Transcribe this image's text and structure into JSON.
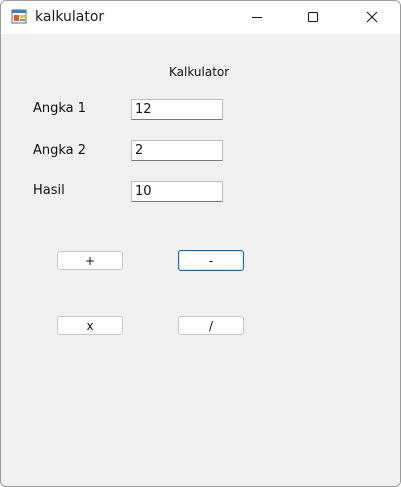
{
  "window": {
    "title": "kalkulator",
    "icon": "winforms-app-icon",
    "controls": [
      "minimize-icon",
      "maximize-icon",
      "close-icon"
    ]
  },
  "form": {
    "title": "Kalkulator",
    "fields": [
      {
        "label": "Angka 1",
        "value": "12"
      },
      {
        "label": "Angka 2",
        "value": "2"
      },
      {
        "label": "Hasil",
        "value": "10"
      }
    ],
    "buttons": {
      "add": "+",
      "subtract": "-",
      "multiply": "x",
      "divide": "/"
    },
    "focused_button": "subtract"
  },
  "colors": {
    "client_background": "#f0f0f0",
    "titlebar_background": "#ffffff",
    "focus_border": "#0067c0"
  }
}
